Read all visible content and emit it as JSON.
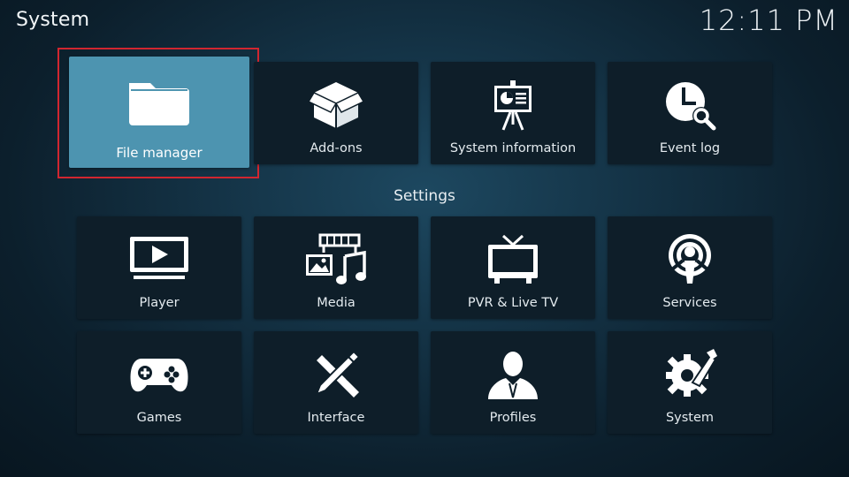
{
  "header": {
    "title": "System",
    "clock": "12:11 PM"
  },
  "top_row": [
    {
      "label": "File manager",
      "icon": "folder-icon",
      "focused": true
    },
    {
      "label": "Add-ons",
      "icon": "addons-box-icon"
    },
    {
      "label": "System information",
      "icon": "presentation-board-icon"
    },
    {
      "label": "Event log",
      "icon": "clock-search-icon"
    }
  ],
  "settings": {
    "title": "Settings",
    "items": [
      {
        "label": "Player",
        "icon": "play-monitor-icon"
      },
      {
        "label": "Media",
        "icon": "media-film-music-icon"
      },
      {
        "label": "PVR & Live TV",
        "icon": "tv-antenna-icon"
      },
      {
        "label": "Services",
        "icon": "broadcast-podcast-icon"
      },
      {
        "label": "Games",
        "icon": "gamepad-icon"
      },
      {
        "label": "Interface",
        "icon": "pencil-ruler-icon"
      },
      {
        "label": "Profiles",
        "icon": "user-profile-icon"
      },
      {
        "label": "System",
        "icon": "gear-wrench-icon"
      }
    ]
  },
  "colors": {
    "focus_tile": "#4d94b0",
    "focus_border": "#d12630",
    "tile_bg": "#0e1e29"
  }
}
